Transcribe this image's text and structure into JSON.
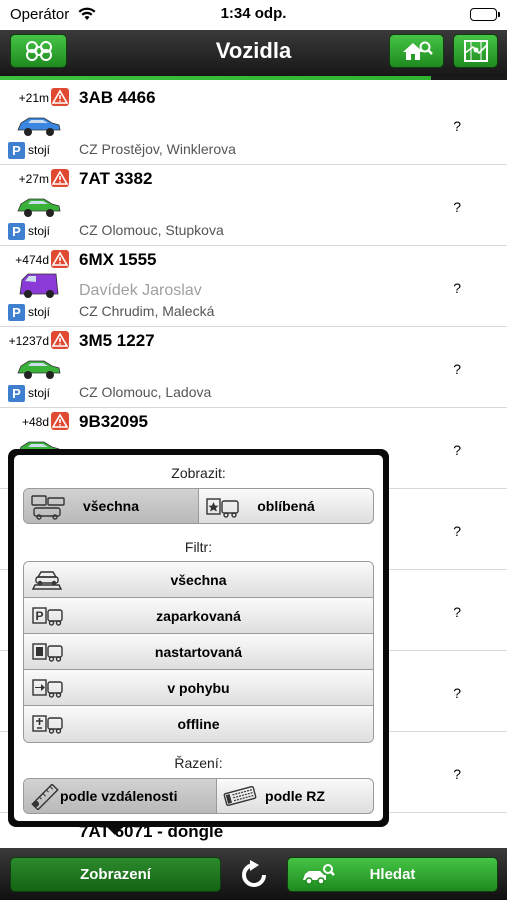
{
  "status_bar": {
    "carrier": "Operátor",
    "time": "1:34 odp."
  },
  "nav": {
    "title": "Vozidla"
  },
  "vehicles": [
    {
      "age": "+21m",
      "plate": "3AB 4466",
      "driver": "",
      "location": "CZ Prostějov, Winklerova",
      "state": "stojí",
      "value": "?",
      "color": "#3a86e0"
    },
    {
      "age": "+27m",
      "plate": "7AT 3382",
      "driver": "",
      "location": "CZ Olomouc, Stupkova",
      "state": "stojí",
      "value": "?",
      "color": "#3ab23a"
    },
    {
      "age": "+474d",
      "plate": "6MX 1555",
      "driver": "Davídek Jaroslav",
      "location": "CZ Chrudim, Malecká",
      "state": "stojí",
      "value": "?",
      "color": "#8a3ad6"
    },
    {
      "age": "+1237d",
      "plate": "3M5 1227",
      "driver": "",
      "location": "CZ Olomouc, Ladova",
      "state": "stojí",
      "value": "?",
      "color": "#3ab23a"
    },
    {
      "age": "+48d",
      "plate": "9B32095",
      "driver": "",
      "location": "",
      "state": "",
      "value": "?",
      "color": "#3ab23a"
    },
    {
      "age": "",
      "plate": "",
      "driver": "",
      "location": "",
      "state": "",
      "value": "?",
      "color": ""
    },
    {
      "age": "",
      "plate": "",
      "driver": "",
      "location": "",
      "state": "",
      "value": "?",
      "color": ""
    },
    {
      "age": "",
      "plate": "",
      "driver": "",
      "location": "",
      "state": "",
      "value": "?",
      "color": ""
    },
    {
      "age": "",
      "plate": "",
      "driver": "",
      "location": "",
      "state": "",
      "value": "?",
      "color": ""
    }
  ],
  "peek_text": "7AT 6071 - dongle",
  "popover": {
    "show_label": "Zobrazit:",
    "show_options": [
      {
        "label": "všechna",
        "selected": true
      },
      {
        "label": "oblíbená",
        "selected": false
      }
    ],
    "filter_label": "Filtr:",
    "filters": [
      {
        "label": "všechna"
      },
      {
        "label": "zaparkovaná"
      },
      {
        "label": "nastartovaná"
      },
      {
        "label": "v pohybu"
      },
      {
        "label": "offline"
      }
    ],
    "sort_label": "Řazení:",
    "sort_options": [
      {
        "label": "podle vzdálenosti",
        "selected": true
      },
      {
        "label": "podle RZ",
        "selected": false
      }
    ]
  },
  "toolbar": {
    "display_label": "Zobrazení",
    "search_label": "Hledat"
  },
  "colors": {
    "accent_green": "#2fb52f",
    "parking_blue": "#3f7fd0",
    "warning_red": "#e04a32"
  }
}
